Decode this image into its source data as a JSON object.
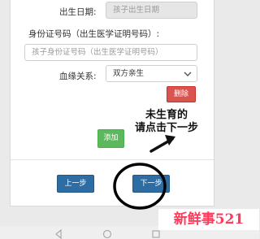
{
  "form": {
    "birth_date_label": "出生日期:",
    "birth_date_placeholder": "孩子出生日期",
    "id_label": "身份证号码（出生医学证明号码）:",
    "id_placeholder": "孩子身份证号码（出生医学证明号码）",
    "relation_label": "血缘关系:",
    "relation_value": "双方亲生",
    "delete_button": "删除",
    "add_button": "添加",
    "prev_button": "上一步",
    "next_button": "下一步"
  },
  "annotation": {
    "line1": "未生育的",
    "line2": "请点击下一步"
  },
  "watermark": "新鲜事521",
  "colors": {
    "delete": "#d9534f",
    "add": "#5cb85c",
    "nav_buttons": "#2e6da4",
    "watermark": "#ff3b5c"
  }
}
